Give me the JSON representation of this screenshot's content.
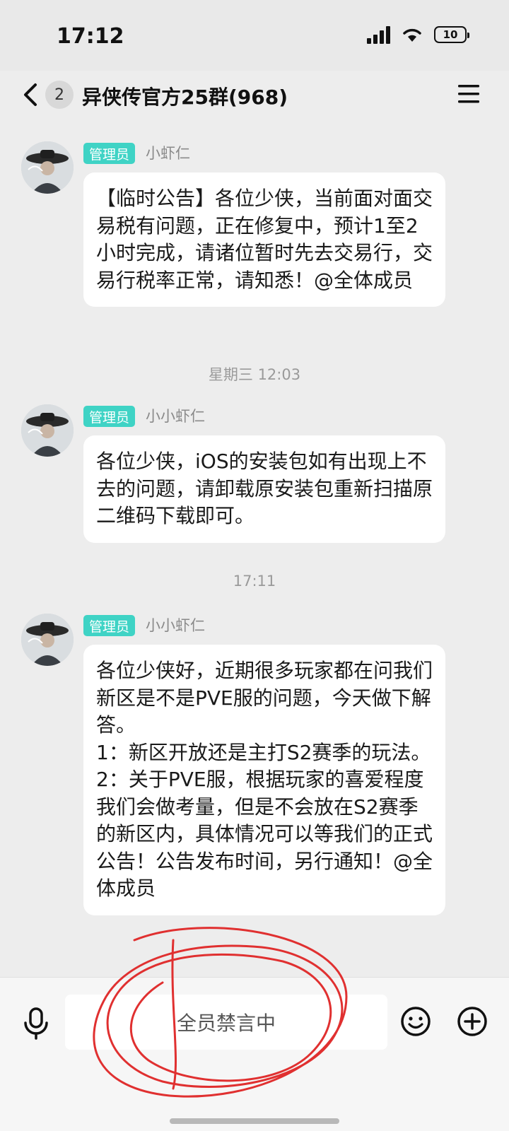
{
  "status_bar": {
    "time": "17:12",
    "battery": "10"
  },
  "header": {
    "unread_count": "2",
    "group_title": "异侠传官方25群(968)"
  },
  "messages": [
    {
      "role": "管理员",
      "sender": "小虾仁",
      "text": "【临时公告】各位少侠，当前面对面交易税有问题，正在修复中，预计1至2小时完成，请诸位暂时先去交易行，交易行税率正常，请知悉！@全体成员"
    },
    {
      "timestamp": "星期三 12:03",
      "role": "管理员",
      "sender": "小小虾仁",
      "text": "各位少侠，iOS的安装包如有出现上不去的问题，请卸载原安装包重新扫描原二维码下载即可。"
    },
    {
      "timestamp": "17:11",
      "role": "管理员",
      "sender": "小小虾仁",
      "text": "各位少侠好，近期很多玩家都在问我们新区是不是PVE服的问题，今天做下解答。\n1：新区开放还是主打S2赛季的玩法。\n2：关于PVE服，根据玩家的喜爱程度我们会做考量，但是不会放在S2赛季的新区内，具体情况可以等我们的正式公告！公告发布时间，另行通知！@全体成员"
    }
  ],
  "input_bar": {
    "muted_text": "全员禁言中"
  },
  "colors": {
    "background": "#ededed",
    "role_badge": "#3fd3c5",
    "annotation": "#e03030"
  },
  "icons": [
    "back-icon",
    "menu-icon",
    "mic-icon",
    "emoji-icon",
    "plus-icon"
  ]
}
